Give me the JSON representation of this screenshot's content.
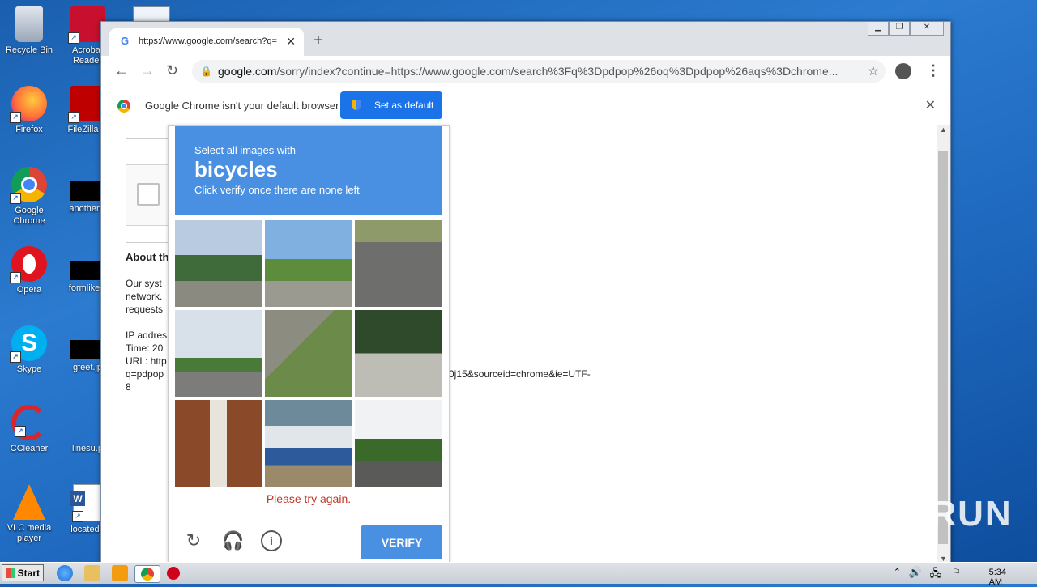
{
  "desktop": {
    "icons": [
      {
        "label": "Recycle Bin"
      },
      {
        "label": "Acrobat Reader"
      },
      {
        "label": "Firefox"
      },
      {
        "label": "FileZilla C"
      },
      {
        "label": "Google Chrome"
      },
      {
        "label": "anotherw"
      },
      {
        "label": "Opera"
      },
      {
        "label": "formlikely"
      },
      {
        "label": "Skype"
      },
      {
        "label": "gfeet.jp"
      },
      {
        "label": "CCleaner"
      },
      {
        "label": "linesu.p"
      },
      {
        "label": "VLC media player"
      },
      {
        "label": "locatede"
      }
    ]
  },
  "browser": {
    "tab_title": "https://www.google.com/search?q=",
    "url_domain": "google.com",
    "url_rest": "/sorry/index?continue=https://www.google.com/search%3Fq%3Dpdpop%26oq%3Dpdpop%26aqs%3Dchrome...",
    "infobar_message": "Google Chrome isn't your default browser",
    "set_default_label": "Set as default"
  },
  "page": {
    "about_heading": "About th",
    "para1": [
      "Our syst",
      "network.",
      "requests"
    ],
    "ip_lines": [
      "IP addres",
      "Time: 20",
      "URL: http",
      "q=pdpop",
      "8"
    ],
    "url_tail": "0j15&sourceid=chrome&ie=UTF-"
  },
  "captcha": {
    "instruction_line1": "Select all images with",
    "target": "bicycles",
    "instruction_line3": "Click verify once there are none left",
    "error": "Please try again.",
    "verify_label": "VERIFY"
  },
  "watermark": "ANY RUN",
  "taskbar": {
    "start_label": "Start",
    "clock": "5:34 AM"
  }
}
